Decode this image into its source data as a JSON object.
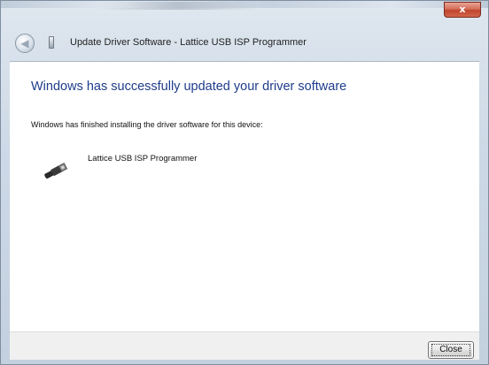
{
  "window": {
    "title": "Update Driver Software - Lattice USB ISP Programmer",
    "close_glyph": "x",
    "back_glyph": "◀"
  },
  "content": {
    "heading": "Windows has successfully updated your driver software",
    "message": "Windows has finished installing the driver software for this device:",
    "device_name": "Lattice USB ISP Programmer",
    "device_icon": "usb-connector-icon"
  },
  "footer": {
    "close_label": "Close"
  },
  "colors": {
    "heading": "#1e3c8c",
    "footer_bg": "#f0f0f0"
  }
}
